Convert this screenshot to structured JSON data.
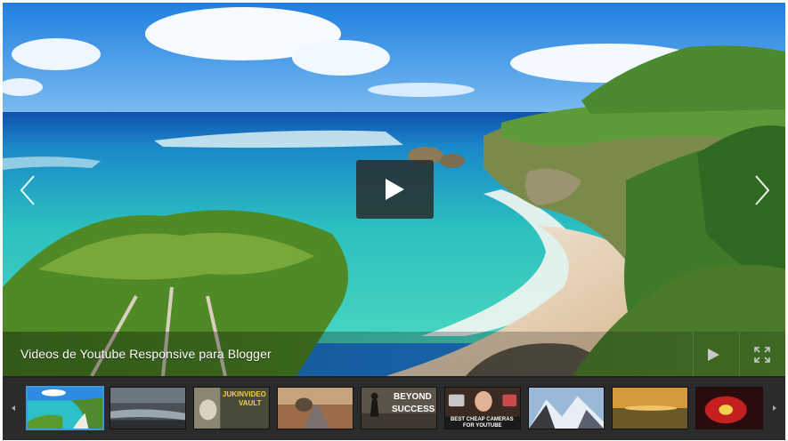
{
  "player": {
    "video_title": "Videos de Youtube Responsive para Blogger",
    "play_icon": "play-icon",
    "prev_icon": "chevron-left-icon",
    "next_icon": "chevron-right-icon",
    "controls": {
      "play": "play-icon",
      "fullscreen": "fullscreen-icon"
    }
  },
  "thumbnails": [
    {
      "label": "",
      "active": true
    },
    {
      "label": "",
      "active": false
    },
    {
      "label": "JUKINVIDEO",
      "label2": "VAULT",
      "active": false
    },
    {
      "label": "",
      "active": false
    },
    {
      "label": "BEYOND",
      "label2": "SUCCESS",
      "active": false
    },
    {
      "label": "BEST CHEAP CAMERAS",
      "label2": "FOR YOUTUBE",
      "active": false
    },
    {
      "label": "",
      "active": false
    },
    {
      "label": "",
      "active": false
    },
    {
      "label": "",
      "active": false
    }
  ],
  "colors": {
    "accent": "#3a9bd8",
    "strip_bg": "#2b2b2b",
    "overlay": "#282c2c"
  }
}
